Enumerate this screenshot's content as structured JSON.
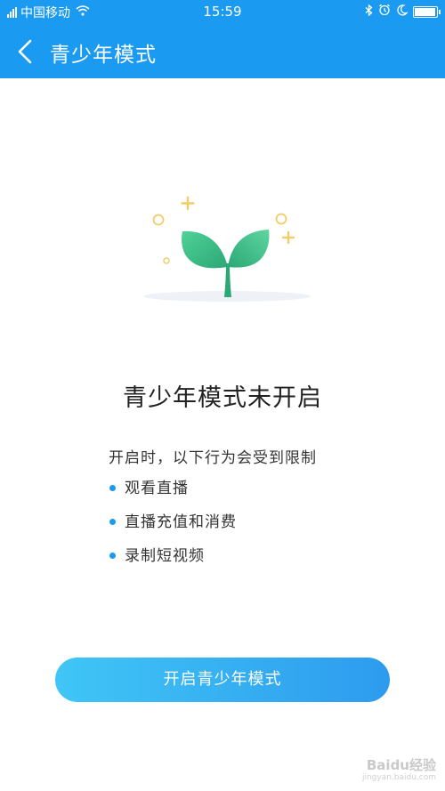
{
  "status_bar": {
    "carrier": "中国移动",
    "time": "15:59",
    "battery_level": 0.9
  },
  "header": {
    "title": "青少年模式",
    "back_icon": "chevron-left-icon"
  },
  "colors": {
    "primary": "#1a9af0",
    "button_gradient_start": "#40c6f6",
    "button_gradient_end": "#2d9bee",
    "leaf_start": "#4fd197",
    "leaf_end": "#2ba876",
    "sparkle": "#f3cc6a"
  },
  "main": {
    "title": "青少年模式未开启",
    "intro": "开启时，以下行为会受到限制",
    "restrictions": [
      "观看直播",
      "直播充值和消费",
      "录制短视频"
    ]
  },
  "action": {
    "enable_label": "开启青少年模式"
  },
  "watermark": {
    "brand": "Baidu经验",
    "url": "jingyan.baidu.com"
  }
}
